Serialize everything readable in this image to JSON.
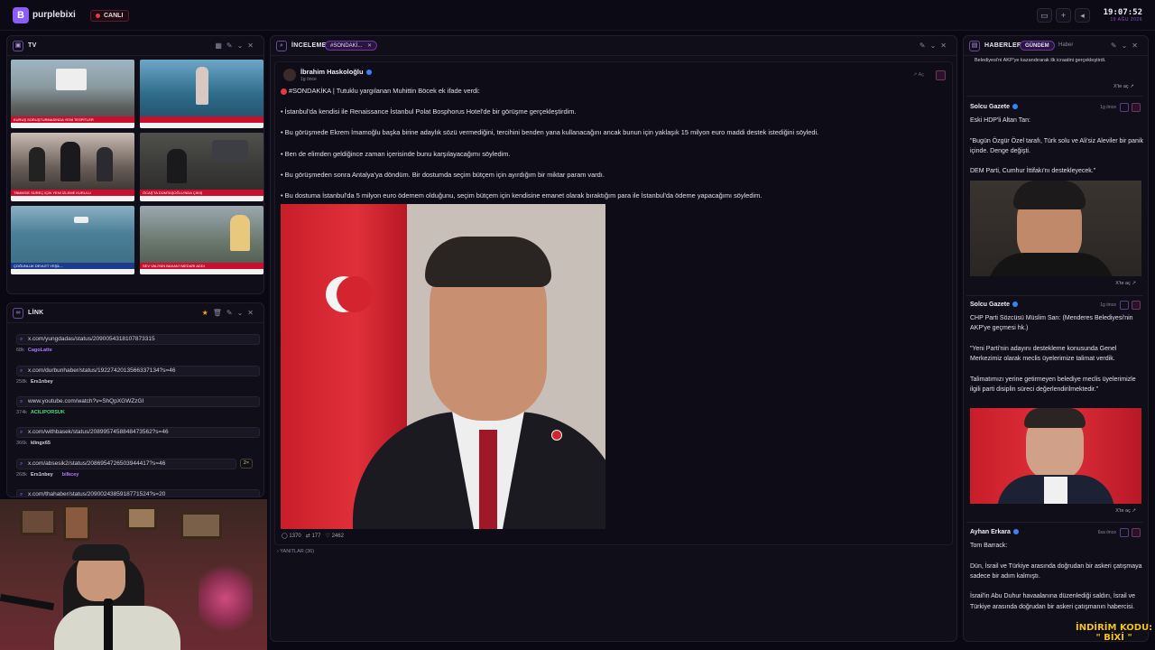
{
  "app": {
    "brand": "purplebixi",
    "live_label": "CANLI"
  },
  "clock": {
    "time": "19:07:52",
    "date": "19 AĞU 2026"
  },
  "tv": {
    "title": "TV",
    "thumbs": [
      {
        "ticker": "KURUŞ SORUŞTURMASINDA YENİ TESPİTLER"
      },
      {
        "ticker": ""
      },
      {
        "ticker": "TBMM'DE SÜREÇ İÇİN YENİ İZLEME KURULU"
      },
      {
        "ticker": "ÖCAŞ'TA DÜMTAŞOĞLU'NDA ÇIKIŞ"
      },
      {
        "ticker": "ÇOĞUNLUK DEVLET YEŞİL..."
      },
      {
        "ticker": "SEV VALİ'NİN BAKAN'I MEDARI ADDI"
      }
    ]
  },
  "link": {
    "title": "LİNK",
    "items": [
      {
        "url": "x.com/yungdadas/status/2090054318107873315",
        "age": "68k",
        "user": "CagoLatte",
        "user2": "",
        "badge": ""
      },
      {
        "url": "x.com/durbunhaber/status/1922742013566337134?s=46",
        "age": "258k",
        "user": "Ers1nbey",
        "user2": "",
        "badge": ""
      },
      {
        "url": "www.youtube.com/watch?v=ShQpXGWZzGI",
        "age": "374k",
        "user": "ACILIPORSUK",
        "user2": "",
        "badge": ""
      },
      {
        "url": "x.com/withbasek/status/2089957458848473562?s=46",
        "age": "366k",
        "user": "klingx65",
        "user2": "",
        "badge": ""
      },
      {
        "url": "x.com/absesik2/status/2086954726503944417?s=46",
        "age": "268k",
        "user": "Ers1nbey",
        "user2": "bilkcey",
        "badge": "2×"
      },
      {
        "url": "x.com/thahaber/status/2090024385918771524?s=20",
        "age": "",
        "user": "",
        "user2": "",
        "badge": ""
      }
    ]
  },
  "review": {
    "title": "İNCELEME",
    "tag": "#SONDAKİ...",
    "author": "İbrahim Haskoloğlu",
    "time": "1g önce",
    "open_label": "Aç",
    "lines": [
      "#SONDAKİKA | Tutuklu yargılanan Muhittin Böcek ek ifade verdi:",
      "• İstanbul'da kendisi ile Renaissance İstanbul Polat Bosphorus Hotel'de bir görüşme gerçekleştirdim.",
      "• Bu görüşmede Ekrem İmamoğlu başka birine adaylık sözü vermediğini, tercihini benden yana kullanacağını ancak bunun için yaklaşık 15 milyon euro maddi destek istediğini söyledi.",
      "• Ben de elimden geldiğince zaman içerisinde bunu karşılayacağımı söyledim.",
      "• Bu görüşmeden sonra Antalya'ya döndüm. Bir dostumda seçim bütçem için ayırdığım bir miktar param vardı.",
      "• Bu dostuma İstanbul'da 5 milyon euro ödemem olduğunu, seçim bütçem için kendisine emanet olarak bıraktığım para ile İstanbul'da ödeme yapacağımı söyledim."
    ],
    "stats": {
      "comments": "1370",
      "retweets": "177",
      "likes": "2462"
    },
    "replies_label": "YANITLAR (36)"
  },
  "news": {
    "title": "HABERLER",
    "tab_active": "GÜNDEM",
    "tab_other": "Haber",
    "top_text": "Belediyesi'ni AKP'ye kazandırarak ilk icraatini gerçekleştirdi.",
    "open_label": "X'te aç",
    "cards": [
      {
        "author": "Solcu Gazete",
        "time": "1g önce",
        "paras": [
          "Eski HDP'li Altan Tan:",
          "\"Bugün Özgür Özel tarafı, Türk solu ve Ali'siz Aleviler bir panik içinde. Denge değişti.",
          "DEM Parti, Cumhur İttifakı'nı destekleyecek.\""
        ]
      },
      {
        "author": "Solcu Gazete",
        "time": "1g önce",
        "paras": [
          "CHP Parti Sözcüsü Müslim Sarı: (Menderes Belediyesi'nin AKP'ye geçmesi hk.)",
          "\"Yeni Parti'nin adayını destekleme konusunda Genel Merkezimiz olarak meclis üyelerimize talimat verdik.",
          "Talimatımızı yerine getirmeyen belediye meclis üyelerimizle ilgili parti disiplin süreci değerlendirilmektedir.\""
        ]
      },
      {
        "author": "Ayhan Erkara",
        "time": "6sa önce",
        "paras": [
          "Tom Barrack:",
          "Dün, İsrail ve Türkiye arasında doğrudan bir askeri çatışmaya sadece bir adım kalmıştı.",
          "İsrail'in Abu Duhur havaalanına düzenlediği saldırı, İsrail ve Türkiye arasında doğrudan bir askeri çatışmanın habercisi."
        ]
      }
    ]
  },
  "watermark": {
    "line1": "İNDİRİM KODU:",
    "line2": "\" BİXİ \""
  },
  "colors": {
    "accent": "#8b5cf6",
    "live": "#e53945",
    "verified": "#3b82f6"
  }
}
